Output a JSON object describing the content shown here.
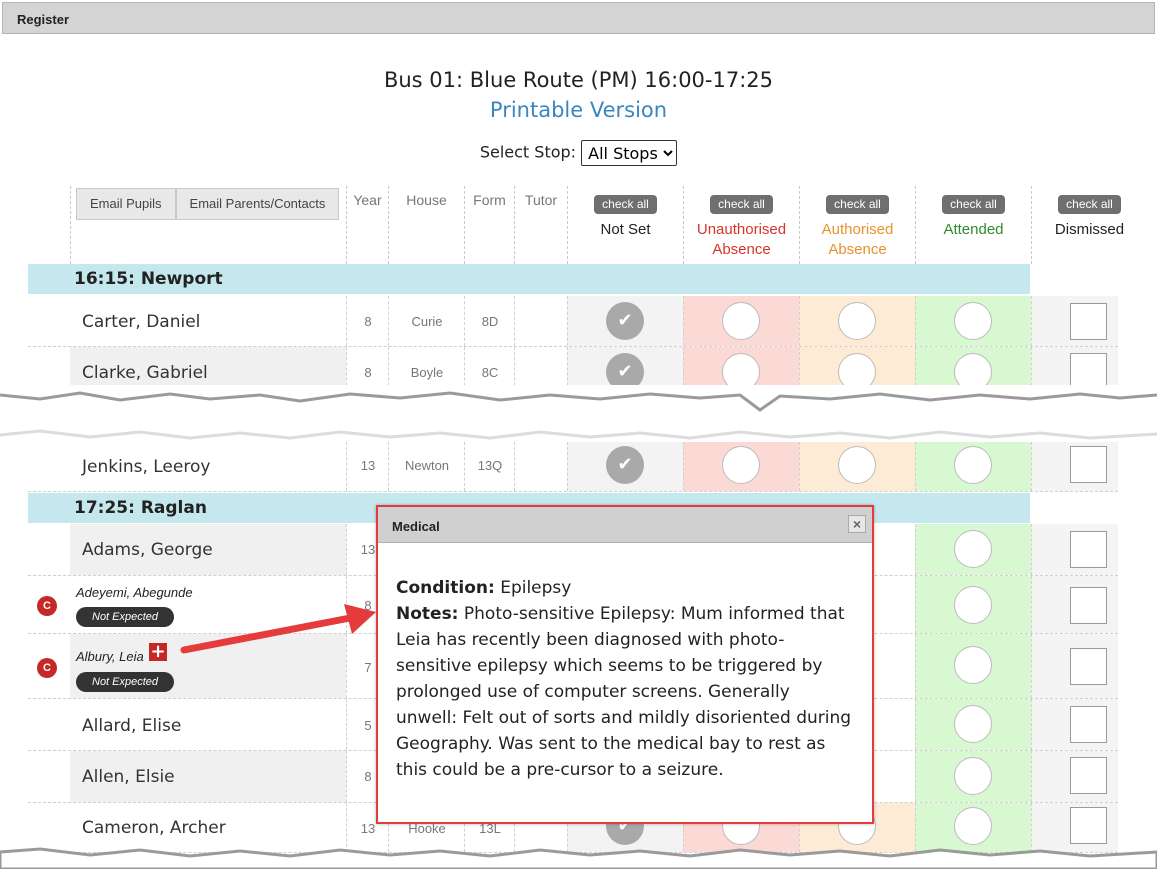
{
  "window": {
    "title": "Register"
  },
  "header": {
    "route_title": "Bus 01: Blue Route (PM) 16:00-17:25",
    "printable_link": "Printable Version",
    "select_stop_label": "Select Stop:",
    "select_stop_value": "All Stops"
  },
  "toolbar": {
    "email_pupils": "Email Pupils",
    "email_parents": "Email Parents/Contacts"
  },
  "columns": {
    "year": "Year",
    "house": "House",
    "form": "Form",
    "tutor": "Tutor",
    "check_all": "check all",
    "not_set": "Not Set",
    "unauthorised": "Unauthorised Absence",
    "authorised": "Authorised Absence",
    "attended": "Attended",
    "dismissed": "Dismissed"
  },
  "status_colors": {
    "unauthorised": "#d9342b",
    "authorised": "#e8922c",
    "attended": "#2e8b2e",
    "link": "#3a87c0",
    "band": "#c5e8ee"
  },
  "groups": [
    {
      "label": "16:15: Newport"
    },
    {
      "label": "17:25: Raglan"
    }
  ],
  "rows": [
    {
      "name": "Carter, Daniel",
      "year": "8",
      "house": "Curie",
      "form": "8D"
    },
    {
      "name": "Clarke, Gabriel",
      "year": "8",
      "house": "Boyle",
      "form": "8C"
    },
    {
      "name": "Jenkins, Leeroy",
      "year": "13",
      "house": "Newton",
      "form": "13Q"
    },
    {
      "name": "Adams, George",
      "year": "13"
    },
    {
      "name": "Adeyemi, Abegunde",
      "year": "8",
      "badge": "C",
      "status": "Not Expected"
    },
    {
      "name": "Albury, Leia",
      "year": "7",
      "badge": "C",
      "status": "Not Expected"
    },
    {
      "name": "Allard, Elise",
      "year": "5"
    },
    {
      "name": "Allen, Elsie",
      "year": "8"
    },
    {
      "name": "Cameron, Archer",
      "year": "13",
      "house": "Hooke",
      "form": "13L"
    }
  ],
  "modal": {
    "title": "Medical",
    "close": "×",
    "condition_label": "Condition:",
    "condition_value": "Epilepsy",
    "notes_label": "Notes:",
    "notes_value": "Photo-sensitive Epilepsy: Mum informed that Leia has recently been diagnosed with photo-sensitive epilepsy which seems to be triggered by prolonged use of computer screens. Generally unwell: Felt out of sorts and mildly disoriented during Geography. Was sent to the medical bay to rest as this could be a pre-cursor to a seizure."
  }
}
